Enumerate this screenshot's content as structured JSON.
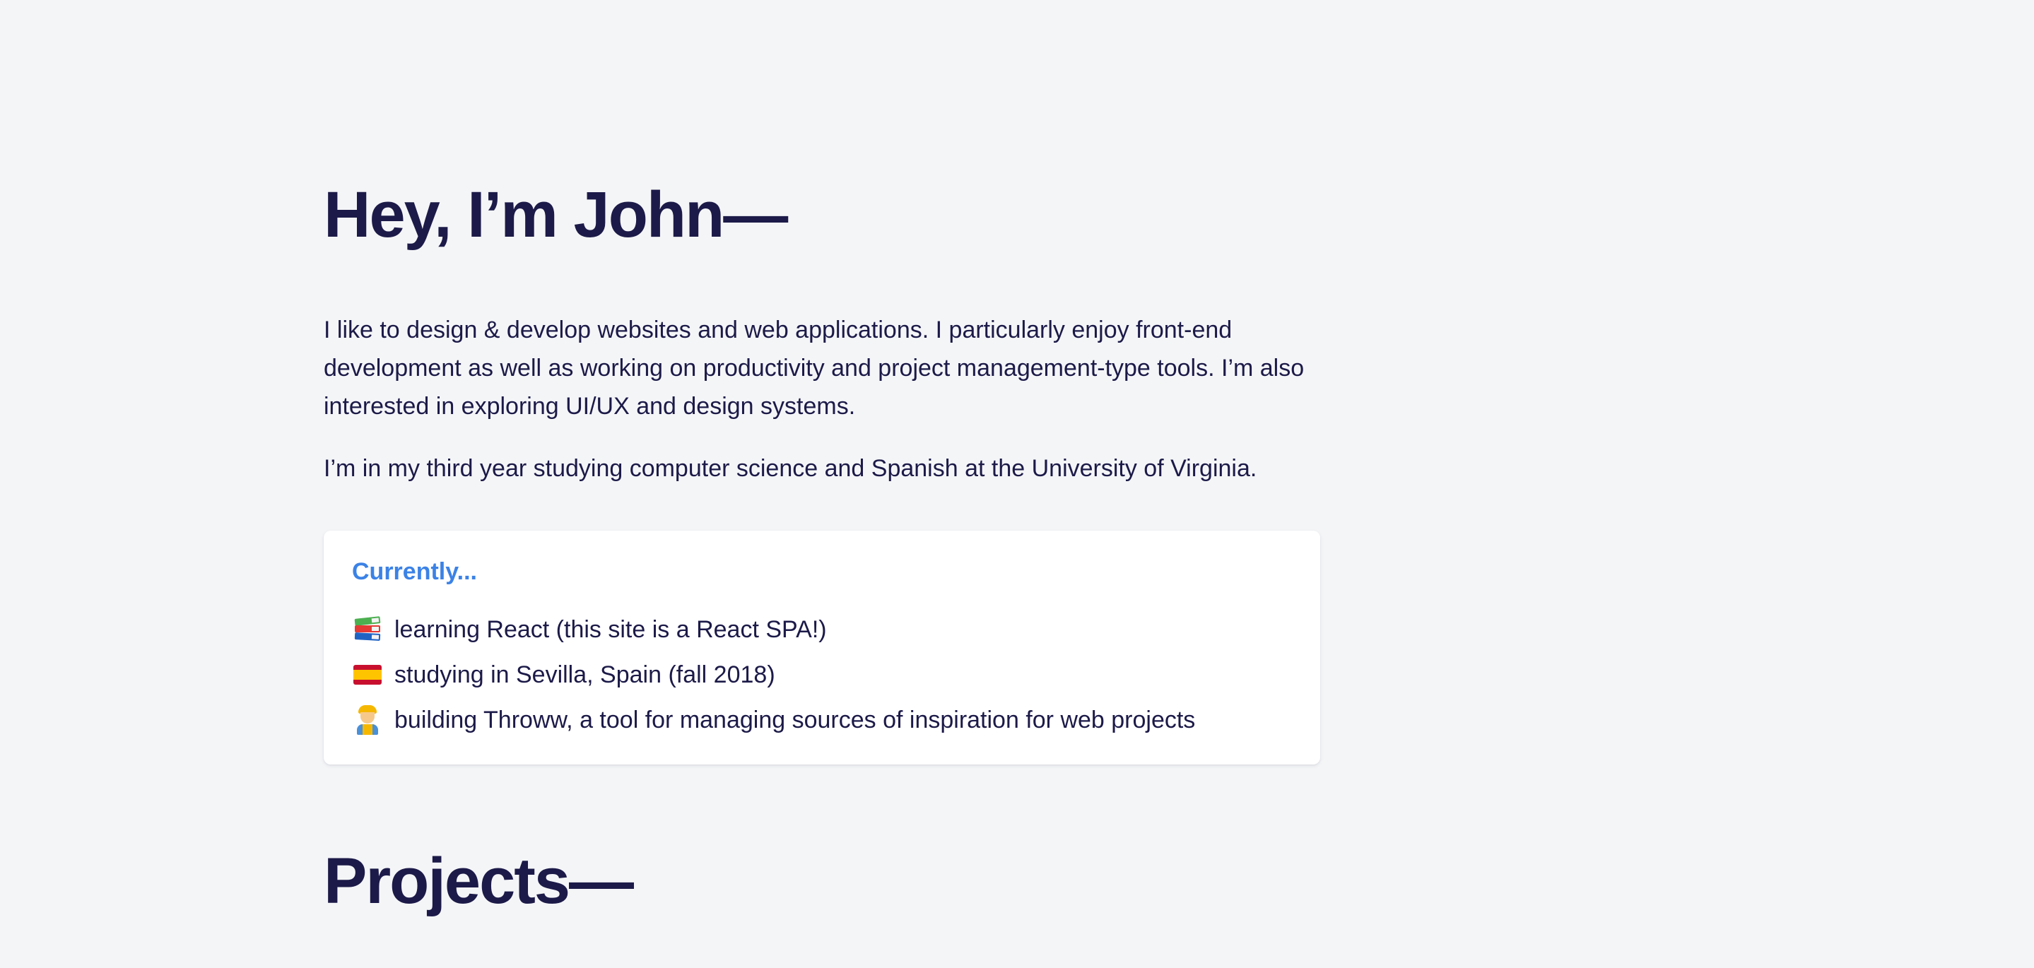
{
  "hero": {
    "title": "Hey, I’m John—"
  },
  "about": {
    "intro": "I like to design & develop websites and web applications. I particularly enjoy front-end development as well as working on productivity and project management-type tools. I’m also interested in exploring UI/UX and design systems.",
    "study": "I’m in my third year studying computer science and Spanish at the University of Virginia."
  },
  "currently": {
    "title": "Currently...",
    "accent_color": "#3b82e6",
    "items": [
      {
        "icon": "books-icon",
        "text": "learning React (this site is a React SPA!)"
      },
      {
        "icon": "spain-flag-icon",
        "text": "studying in Sevilla, Spain (fall 2018)"
      },
      {
        "icon": "construction-worker-icon",
        "text": "building Throww, a tool for managing sources of inspiration for web projects"
      }
    ]
  },
  "projects": {
    "title": "Projects—"
  },
  "colors": {
    "background": "#f4f5f7",
    "text": "#1c1a48",
    "card": "#ffffff"
  }
}
